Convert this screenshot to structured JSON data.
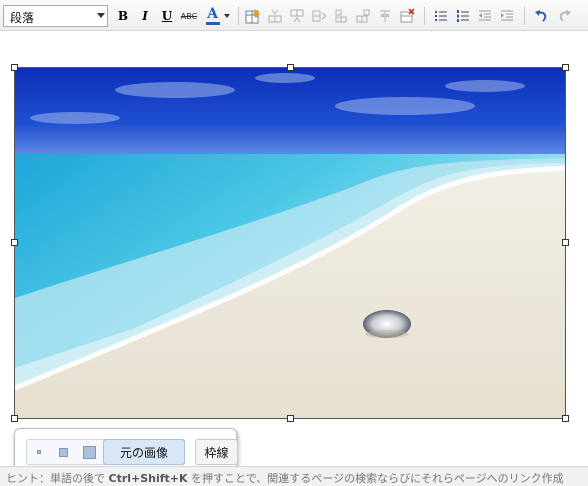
{
  "toolbar": {
    "format_select": {
      "value": "段落"
    },
    "bold_label": "B",
    "italic_label": "I",
    "underline_label": "U",
    "strike_label": "ABC",
    "fontcolor_label": "A",
    "icons": [
      "bold-icon",
      "italic-icon",
      "underline-icon",
      "strikethrough-icon",
      "font-color-icon",
      "edit-table-icon",
      "insert-row-above-icon",
      "insert-row-below-icon",
      "insert-column-icon",
      "merge-cells-icon",
      "split-cells-icon",
      "delete-column-icon",
      "delete-table-icon",
      "bulleted-list-icon",
      "numbered-list-icon",
      "outdent-icon",
      "indent-icon",
      "undo-icon",
      "redo-icon"
    ],
    "accent_color": "#1f5fbf"
  },
  "image": {
    "description_icon": "beach-photo"
  },
  "image_toolbar": {
    "original_size_label": "元の画像",
    "border_label": "枠線",
    "size_icons": [
      "size-small-icon",
      "size-medium-icon",
      "size-large-icon"
    ]
  },
  "statusbar": {
    "hint_prefix": "ヒント：単語の後で ",
    "hint_key": "Ctrl+Shift+K",
    "hint_suffix": " を押すことで、関連するページの検索ならびにそれらページへのリンク作成"
  }
}
